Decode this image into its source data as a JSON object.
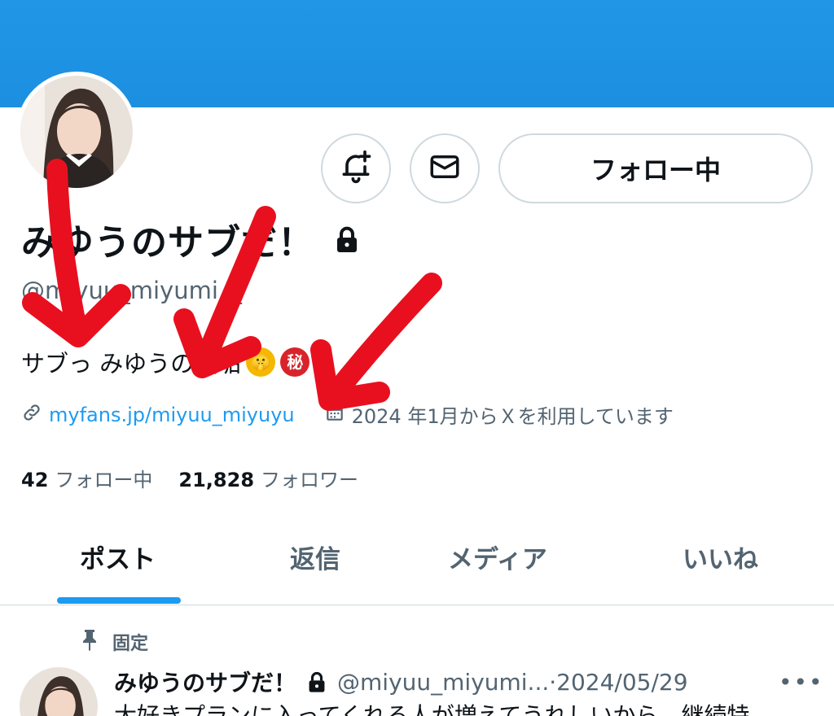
{
  "profile": {
    "display_name": "みゆうのサブだ！",
    "handle": "@miyuu_miyumi__",
    "bio": "サブっ みゆうの裏垢",
    "link": "myfans.jp/miyuu_miyuyu",
    "joined": "2024 年1月からＸを利用しています",
    "following_count": "42",
    "following_label": "フォロー中",
    "followers_count": "21,828",
    "followers_label": "フォロワー"
  },
  "actions": {
    "follow_label": "フォロー中"
  },
  "icons": {
    "bell": "bell-plus-icon",
    "mail": "mail-icon",
    "lock": "lock-icon",
    "link": "link-icon",
    "calendar": "calendar-icon",
    "pin": "pin-icon",
    "more": "more-icon"
  },
  "tabs": [
    {
      "label": "ポスト",
      "active": true
    },
    {
      "label": "返信",
      "active": false
    },
    {
      "label": "メディア",
      "active": false
    },
    {
      "label": "いいね",
      "active": false
    }
  ],
  "pinned_post": {
    "pinned_label": "固定",
    "author_name": "みゆうのサブだ！",
    "author_handle": "@miyuu_miyumi...",
    "separator": " · ",
    "date": "2024/05/29",
    "more_label": "•••",
    "text": "大好きプランに入ってくれる人が増えてうれしいから　継続特"
  },
  "emojis": {
    "shush": "🤫",
    "secret": "秘"
  },
  "colors": {
    "banner": "#1c8fe0",
    "link": "#1d9bf0",
    "annotation_arrow": "#e8101f",
    "secondary_text": "#536471"
  }
}
